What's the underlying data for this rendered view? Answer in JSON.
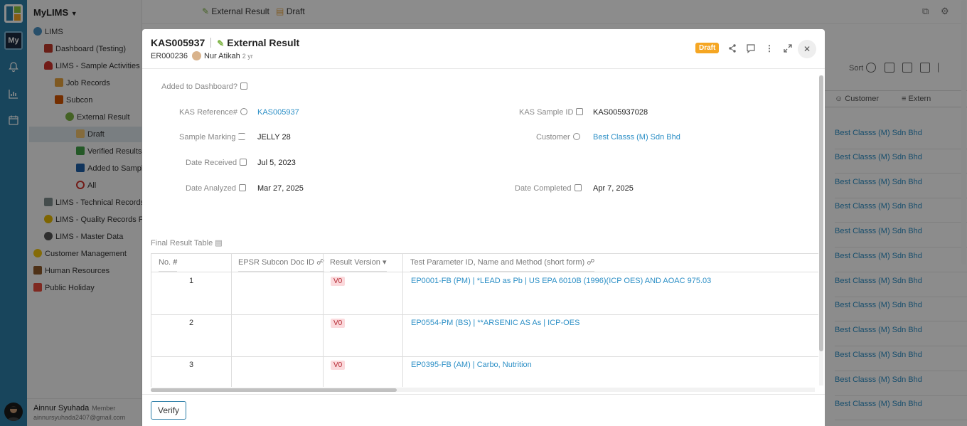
{
  "app": {
    "rail_badge": "My",
    "name": "MyLIMS"
  },
  "sidebar": {
    "items": [
      {
        "label": "LIMS"
      },
      {
        "label": "Dashboard (Testing)"
      },
      {
        "label": "LIMS - Sample Activities"
      },
      {
        "label": "Job Records"
      },
      {
        "label": "Subcon"
      },
      {
        "label": "External Result"
      },
      {
        "label": "Draft"
      },
      {
        "label": "Verified Results"
      },
      {
        "label": "Added to Sample"
      },
      {
        "label": "All"
      },
      {
        "label": "LIMS - Technical Records F"
      },
      {
        "label": "LIMS - Quality Records For"
      },
      {
        "label": "LIMS - Master Data"
      },
      {
        "label": "Customer Management"
      },
      {
        "label": "Human Resources"
      },
      {
        "label": "Public Holiday"
      }
    ],
    "user": {
      "name": "Ainnur Syuhada",
      "role": "Member",
      "email": "ainnursyuhada2407@gmail.com"
    }
  },
  "topbar": {
    "crumb1": "External Result",
    "crumb2": "Draft"
  },
  "background": {
    "sort_label": "Sort",
    "col_customer": "Customer",
    "col_extern": "Extern",
    "rows": [
      "Best Classs (M) Sdn Bhd",
      "Best Classs (M) Sdn Bhd",
      "Best Classs (M) Sdn Bhd",
      "Best Classs (M) Sdn Bhd",
      "Best Classs (M) Sdn Bhd",
      "Best Classs (M) Sdn Bhd",
      "Best Classs (M) Sdn Bhd",
      "Best Classs (M) Sdn Bhd",
      "Best Classs (M) Sdn Bhd",
      "Best Classs (M) Sdn Bhd",
      "Best Classs (M) Sdn Bhd",
      "Best Classs (M) Sdn Bhd"
    ]
  },
  "modal": {
    "record_id": "KAS005937",
    "record_type": "External Result",
    "code": "ER000236",
    "author": "Nur Atikah",
    "age": "2 yr",
    "status": "Draft",
    "added_to_dashboard_label": "Added to Dashboard?",
    "fields": {
      "kas_reference_label": "KAS Reference#",
      "kas_reference_value": "KAS005937",
      "kas_sample_id_label": "KAS Sample ID",
      "kas_sample_id_value": "KAS005937028",
      "sample_marking_label": "Sample Marking",
      "sample_marking_value": "JELLY 28",
      "customer_label": "Customer",
      "customer_value": "Best Classs (M) Sdn Bhd",
      "date_received_label": "Date Received",
      "date_received_value": "Jul 5, 2023",
      "date_analyzed_label": "Date Analyzed",
      "date_analyzed_value": "Mar 27, 2025",
      "date_completed_label": "Date Completed",
      "date_completed_value": "Apr 7, 2025"
    },
    "table": {
      "title": "Final Result Table",
      "headers": {
        "no": "No.",
        "epsr": "EPSR Subcon Doc ID",
        "version": "Result Version",
        "param": "Test Parameter ID, Name and Method (short form)"
      },
      "rows": [
        {
          "no": "1",
          "version": "V0",
          "param": "EP0001-FB (PM) | *LEAD as Pb | US EPA 6010B (1996)(ICP OES) AND AOAC 975.03"
        },
        {
          "no": "2",
          "version": "V0",
          "param": "EP0554-PM (BS) | **ARSENIC AS As | ICP-OES"
        },
        {
          "no": "3",
          "version": "V0",
          "param": "EP0395-FB (AM) | Carbo, Nutrition"
        }
      ]
    },
    "verify_label": "Verify"
  },
  "colors": {
    "rail": "#2d7ea8",
    "link": "#2c8fc6",
    "draft_badge": "#f5a623",
    "version_badge_bg": "#fbd9dc"
  }
}
